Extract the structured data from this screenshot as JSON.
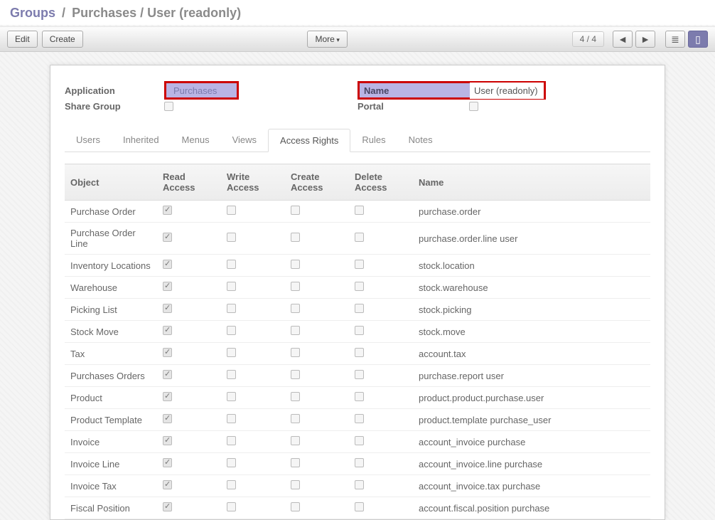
{
  "breadcrumb": {
    "root": "Groups",
    "current": "Purchases / User (readonly)"
  },
  "toolbar": {
    "edit": "Edit",
    "create": "Create",
    "more": "More",
    "pager": "4 / 4"
  },
  "form": {
    "application_label": "Application",
    "application_value": "Purchases",
    "sharegroup_label": "Share Group",
    "sharegroup_checked": false,
    "name_label": "Name",
    "name_value": "User (readonly)",
    "portal_label": "Portal",
    "portal_checked": false
  },
  "tabs": [
    {
      "label": "Users",
      "active": false
    },
    {
      "label": "Inherited",
      "active": false
    },
    {
      "label": "Menus",
      "active": false
    },
    {
      "label": "Views",
      "active": false
    },
    {
      "label": "Access Rights",
      "active": true
    },
    {
      "label": "Rules",
      "active": false
    },
    {
      "label": "Notes",
      "active": false
    }
  ],
  "grid": {
    "headers": [
      "Object",
      "Read Access",
      "Write Access",
      "Create Access",
      "Delete Access",
      "Name"
    ],
    "rows": [
      {
        "object": "Purchase Order",
        "read": true,
        "write": false,
        "create": false,
        "delete": false,
        "name": "purchase.order"
      },
      {
        "object": "Purchase Order Line",
        "read": true,
        "write": false,
        "create": false,
        "delete": false,
        "name": "purchase.order.line user"
      },
      {
        "object": "Inventory Locations",
        "read": true,
        "write": false,
        "create": false,
        "delete": false,
        "name": "stock.location"
      },
      {
        "object": "Warehouse",
        "read": true,
        "write": false,
        "create": false,
        "delete": false,
        "name": "stock.warehouse"
      },
      {
        "object": "Picking List",
        "read": true,
        "write": false,
        "create": false,
        "delete": false,
        "name": "stock.picking"
      },
      {
        "object": "Stock Move",
        "read": true,
        "write": false,
        "create": false,
        "delete": false,
        "name": "stock.move"
      },
      {
        "object": "Tax",
        "read": true,
        "write": false,
        "create": false,
        "delete": false,
        "name": "account.tax"
      },
      {
        "object": "Purchases Orders",
        "read": true,
        "write": false,
        "create": false,
        "delete": false,
        "name": "purchase.report user"
      },
      {
        "object": "Product",
        "read": true,
        "write": false,
        "create": false,
        "delete": false,
        "name": "product.product.purchase.user"
      },
      {
        "object": "Product Template",
        "read": true,
        "write": false,
        "create": false,
        "delete": false,
        "name": "product.template purchase_user"
      },
      {
        "object": "Invoice",
        "read": true,
        "write": false,
        "create": false,
        "delete": false,
        "name": "account_invoice purchase"
      },
      {
        "object": "Invoice Line",
        "read": true,
        "write": false,
        "create": false,
        "delete": false,
        "name": "account_invoice.line purchase"
      },
      {
        "object": "Invoice Tax",
        "read": true,
        "write": false,
        "create": false,
        "delete": false,
        "name": "account_invoice.tax purchase"
      },
      {
        "object": "Fiscal Position",
        "read": true,
        "write": false,
        "create": false,
        "delete": false,
        "name": "account.fiscal.position purchase"
      }
    ]
  }
}
